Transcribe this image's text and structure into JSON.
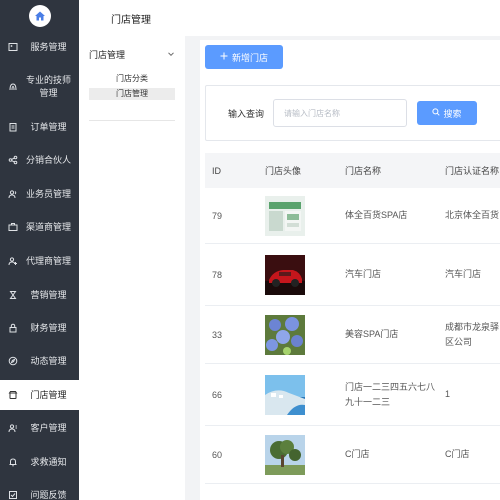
{
  "sidebar": {
    "items": [
      {
        "label": "服务管理",
        "icon": "image-icon"
      },
      {
        "label": "专业的技师管理",
        "icon": "fingerprint-icon"
      },
      {
        "label": "订单管理",
        "icon": "clipboard-icon"
      },
      {
        "label": "分销合伙人",
        "icon": "share-icon"
      },
      {
        "label": "业务员管理",
        "icon": "users-icon"
      },
      {
        "label": "渠道商管理",
        "icon": "briefcase-icon"
      },
      {
        "label": "代理商管理",
        "icon": "user-plus-icon"
      },
      {
        "label": "营销管理",
        "icon": "hourglass-icon"
      },
      {
        "label": "财务管理",
        "icon": "lock-icon"
      },
      {
        "label": "动态管理",
        "icon": "compass-icon"
      },
      {
        "label": "门店管理",
        "icon": "store-icon"
      },
      {
        "label": "客户管理",
        "icon": "customers-icon"
      },
      {
        "label": "求救通知",
        "icon": "bell-icon"
      },
      {
        "label": "问题反馈",
        "icon": "feedback-icon"
      }
    ]
  },
  "subsidebar": {
    "title": "门店管理",
    "group": "门店管理",
    "links": [
      "门店分类",
      "门店管理"
    ]
  },
  "toolbar": {
    "add_label": "新增门店"
  },
  "search": {
    "label": "输入查询",
    "placeholder": "请输入门店名称",
    "button_label": "搜索"
  },
  "table": {
    "headers": {
      "id": "ID",
      "avatar": "门店头像",
      "name": "门店名称",
      "cert": "门店认证名称"
    },
    "rows": [
      {
        "id": "79",
        "name": "体全百货SPA店",
        "cert": "北京体全百货",
        "thumb": "mall"
      },
      {
        "id": "78",
        "name": "汽车门店",
        "cert": "汽车门店",
        "thumb": "car"
      },
      {
        "id": "33",
        "name": "美容SPA门店",
        "cert": "成都市龙泉驿区公司",
        "thumb": "flowers"
      },
      {
        "id": "66",
        "name": "门店一二三四五六七八九十一二三",
        "cert": "1",
        "thumb": "coast"
      },
      {
        "id": "60",
        "name": "C门店",
        "cert": "C门店",
        "thumb": "tree"
      }
    ]
  },
  "colors": {
    "sidebar_bg": "#2f353f",
    "accent": "#5b9bff",
    "page_bg": "#f2f3f5"
  }
}
